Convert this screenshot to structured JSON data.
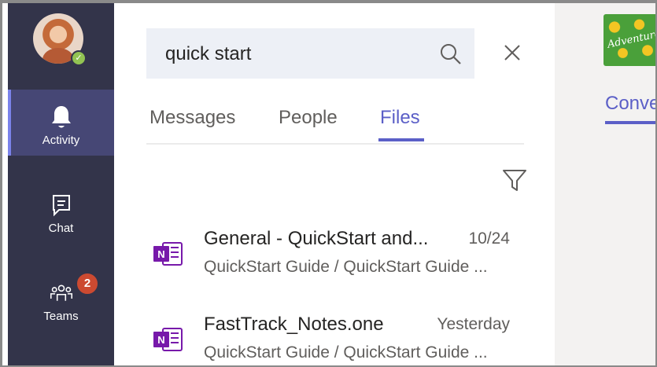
{
  "rail": {
    "items": [
      {
        "label": "Activity",
        "icon": "bell-icon",
        "active": true
      },
      {
        "label": "Chat",
        "icon": "chat-icon"
      },
      {
        "label": "Teams",
        "icon": "teams-icon",
        "badge": "2"
      }
    ],
    "presence": "available"
  },
  "search": {
    "value": "quick start",
    "placeholder": ""
  },
  "tabs": [
    {
      "label": "Messages"
    },
    {
      "label": "People"
    },
    {
      "label": "Files",
      "active": true
    }
  ],
  "files": [
    {
      "name": "General - QuickStart and...",
      "date": "10/24",
      "path": "QuickStart Guide / QuickStart Guide ...",
      "icon": "onenote-icon"
    },
    {
      "name": "FastTrack_Notes.one",
      "date": "Yesterday",
      "path": "QuickStart Guide / QuickStart Guide ...",
      "icon": "onenote-icon"
    }
  ],
  "right_pane": {
    "team_logo_text": "Adventure Works",
    "tab_label": "Conve"
  },
  "colors": {
    "rail_bg": "#33344a",
    "rail_active": "#464775",
    "accent": "#5b5fc7",
    "badge": "#cc4a31",
    "onenote": "#7719aa",
    "presence": "#92c353"
  }
}
